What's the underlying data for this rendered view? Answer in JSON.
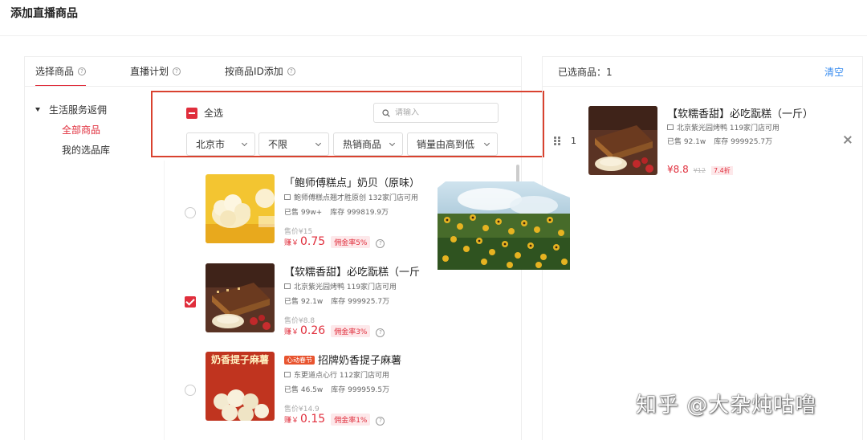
{
  "page_title": "添加直播商品",
  "tabs": [
    {
      "label": "选择商品",
      "active": true
    },
    {
      "label": "直播计划",
      "active": false
    },
    {
      "label": "按商品ID添加",
      "active": false
    }
  ],
  "category_tree": {
    "root": "生活服务返佣",
    "children": [
      {
        "label": "全部商品",
        "active": true
      },
      {
        "label": "我的选品库",
        "active": false
      }
    ]
  },
  "filters": {
    "select_all_label": "全选",
    "search_placeholder": "请输入",
    "city": "北京市",
    "limit": "不限",
    "sort_type": "热销商品",
    "sort_order": "销量由高到低"
  },
  "products": [
    {
      "name": "「鲍师傅糕点」奶贝（原味）",
      "store": "鲍师傅糕点翘才胜原创 132家门店可用",
      "sold": "已售 99w+",
      "stock": "库存 999819.9万",
      "original_price": "售价¥15",
      "earn_label": "赚￥",
      "earn": "0.75",
      "rate": "佣金率5%",
      "selected": false,
      "tag": ""
    },
    {
      "name": "【软糯香甜】必吃翫糕（一斤",
      "store": "北京紫光园烤鸭 119家门店可用",
      "sold": "已售 92.1w",
      "stock": "库存 999925.7万",
      "original_price": "售价¥8.8",
      "earn_label": "赚￥",
      "earn": "0.26",
      "rate": "佣金率3%",
      "selected": true,
      "tag": ""
    },
    {
      "name": "招牌奶香提子麻薯",
      "store": "东更道点心行 112家门店可用",
      "sold": "已售 46.5w",
      "stock": "库存 999959.5万",
      "original_price": "售价¥14.9",
      "earn_label": "赚￥",
      "earn": "0.15",
      "rate": "佣金率1%",
      "selected": false,
      "tag": "心动春节",
      "thumb_text": "奶香提子麻薯"
    }
  ],
  "selected_panel": {
    "count_label": "已选商品：1",
    "clear_label": "清空",
    "item": {
      "index": "1",
      "name": "【软糯香甜】必吃翫糕（一斤）",
      "store": "北京紫光园烤鸭 119家门店可用",
      "sold": "已售 92.1w",
      "stock": "库存 999925.7万",
      "price": "¥8.8",
      "old_price": "¥12",
      "discount": "7.4折"
    }
  },
  "watermark": "知乎 @大杂炖咕噜",
  "colors": {
    "accent": "#e02e3c",
    "link": "#3b8ef0",
    "highlight_box": "#d9422f"
  }
}
